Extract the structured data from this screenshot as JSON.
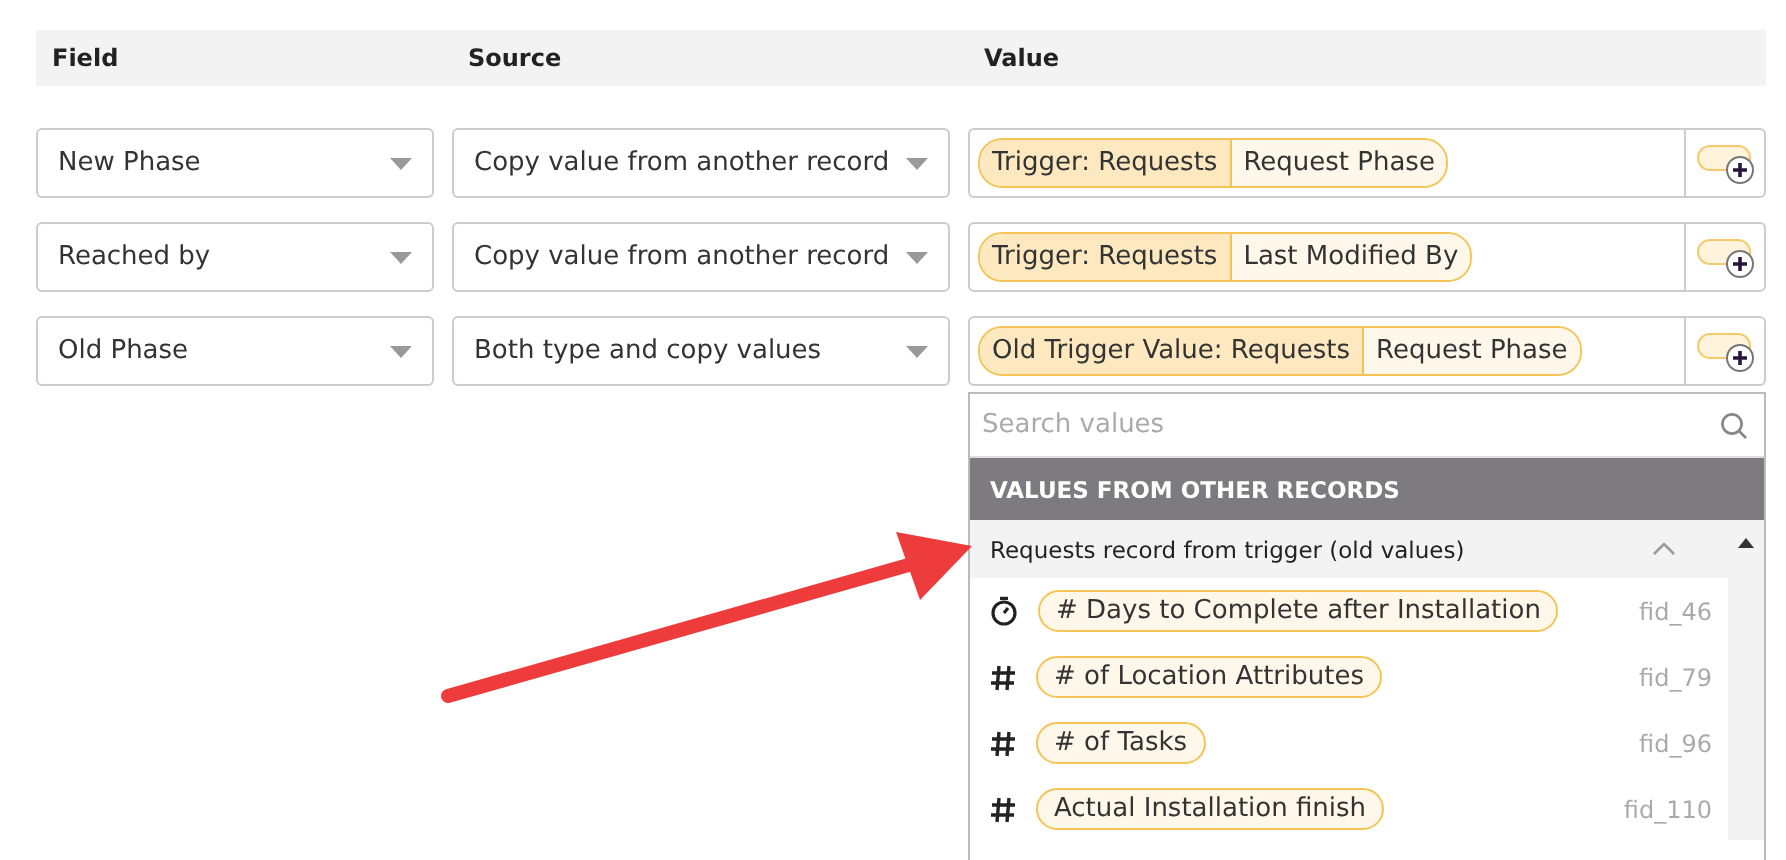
{
  "columns": [
    "Field",
    "Source",
    "Value"
  ],
  "rows": [
    {
      "field": "New Phase",
      "source": "Copy value from another record",
      "value_parts": [
        "Trigger: Requests",
        "Request Phase"
      ]
    },
    {
      "field": "Reached by",
      "source": "Copy value from another record",
      "value_parts": [
        "Trigger: Requests",
        "Last Modified By"
      ]
    },
    {
      "field": "Old Phase",
      "source": "Both type and copy values",
      "value_parts": [
        "Old Trigger Value: Requests",
        "Request Phase"
      ]
    }
  ],
  "dropdown": {
    "search": {
      "placeholder": "Search values"
    },
    "section": "VALUES FROM OTHER RECORDS",
    "group": {
      "label": "Requests record from trigger (old values)",
      "expanded": true
    },
    "items": [
      {
        "kind": "duration",
        "label": "# Days to Complete after Installation",
        "id": "fid_46"
      },
      {
        "kind": "numeric",
        "label": "# of Location Attributes",
        "id": "fid_79"
      },
      {
        "kind": "numeric",
        "label": "# of Tasks",
        "id": "fid_96"
      },
      {
        "kind": "numeric",
        "label": "Actual Installation finish",
        "id": "fid_110"
      }
    ]
  }
}
